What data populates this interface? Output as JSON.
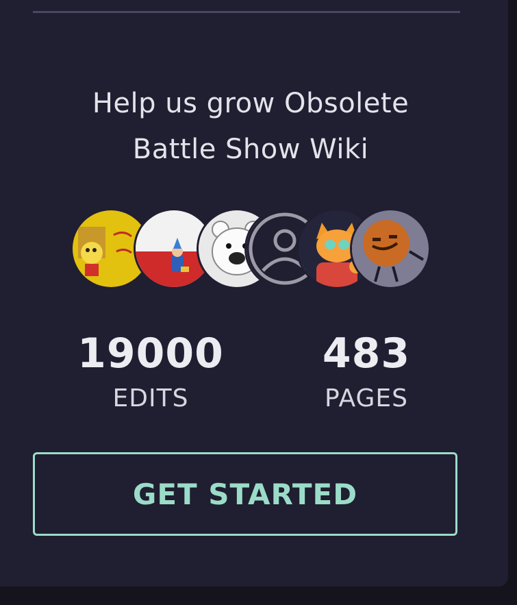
{
  "promo": {
    "headline_line1": "Help us grow Obsolete",
    "headline_line2": "Battle Show Wiki"
  },
  "contributors": [
    {
      "name": "contributor-avatar-1",
      "icon": "yellow-character-avatar"
    },
    {
      "name": "contributor-avatar-2",
      "icon": "red-white-flag-avatar"
    },
    {
      "name": "contributor-avatar-3",
      "icon": "polar-bear-avatar"
    },
    {
      "name": "contributor-avatar-4",
      "icon": "default-user-icon"
    },
    {
      "name": "contributor-avatar-5",
      "icon": "orange-cat-avatar"
    },
    {
      "name": "contributor-avatar-6",
      "icon": "cookie-character-avatar"
    }
  ],
  "stats": {
    "edits_value": "19000",
    "edits_label": "EDITS",
    "pages_value": "483",
    "pages_label": "PAGES"
  },
  "cta": {
    "label": "GET STARTED"
  },
  "colors": {
    "card_background": "#201e31",
    "accent": "#9bdcc8",
    "text": "#e4e3ea"
  }
}
